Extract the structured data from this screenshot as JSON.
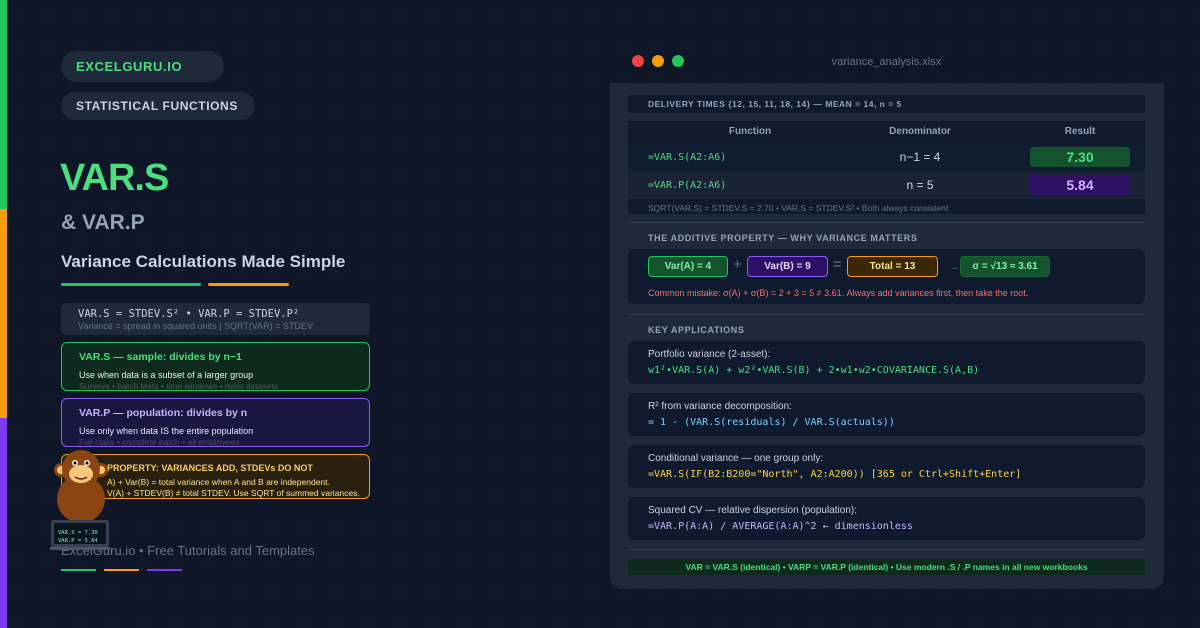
{
  "brand": "EXCELGURU.IO",
  "category": "STATISTICAL FUNCTIONS",
  "title": "VAR.S",
  "subtitle": "& VAR.P",
  "tagline": "Variance Calculations Made Simple",
  "colors": {
    "green": "#22c55e",
    "orange": "#f59e0b",
    "purple": "#7c3aed",
    "background": "#0f1628"
  },
  "formula_box": {
    "line1": "VAR.S = STDEV.S² • VAR.P = STDEV.P²",
    "line2": "Variance = spread in squared units | SQRT(VAR) = STDEV"
  },
  "cards": [
    {
      "heading": "VAR.S — sample: divides by n−1",
      "line1": "Use when data is a subset of a larger group",
      "line2": "Surveys • batch tests • time windows • most datasets"
    },
    {
      "heading": "VAR.P — population: divides by n",
      "line1": "Use only when data IS the entire population",
      "line2": "Full class • complete batch • all employees"
    },
    {
      "heading": "PROPERTY: VARIANCES ADD, STDEVs DO NOT",
      "line1": "A) + Var(B) = total variance when A and B are independent.",
      "line2": "V(A) + STDEV(B) ≠ total STDEV. Use SQRT of summed variances."
    }
  ],
  "footer": "ExcelGuru.io • Free Tutorials and Templates",
  "mascot_screen": {
    "line1": "VAR.S = 7.30",
    "line2": "VAR.P = 5.84"
  },
  "window": {
    "title": "variance_analysis.xlsx",
    "data_title": "DELIVERY TIMES {12, 15, 11, 18, 14} — MEAN = 14, n = 5",
    "table": {
      "headers": [
        "Function",
        "Denominator",
        "Result"
      ],
      "rows": [
        {
          "fn": "=VAR.S(A2:A6)",
          "den": "n−1 = 4",
          "res": "7.30"
        },
        {
          "fn": "=VAR.P(A2:A6)",
          "den": "n = 5",
          "res": "5.84"
        }
      ],
      "note": "SQRT(VAR.S) = STDEV.S = 2.70 • VAR.S = STDEV.S² • Both always consistent"
    },
    "additive": {
      "label": "THE ADDITIVE PROPERTY — WHY VARIANCE MATTERS",
      "chip_a": "Var(A) = 4",
      "plus": "+",
      "chip_b": "Var(B) = 9",
      "equals": "=",
      "chip_total": "Total = 13",
      "arrow": "→",
      "chip_sigma": "σ = √13 ≈ 3.61",
      "mistake": "Common mistake: σ(A) + σ(B) = 2 + 3 = 5 ≠ 3.61. Always add variances first, then take the root."
    },
    "applications": {
      "label": "KEY APPLICATIONS",
      "items": [
        {
          "label": "Portfolio variance (2-asset):",
          "formula": "w1²•VAR.S(A) + w2²•VAR.S(B) + 2•w1•w2•COVARIANCE.S(A,B)"
        },
        {
          "label": "R² from variance decomposition:",
          "formula": "= 1 - (VAR.S(residuals) / VAR.S(actuals))"
        },
        {
          "label": "Conditional variance — one group only:",
          "formula": "=VAR.S(IF(B2:B200=\"North\", A2:A200)) [365 or Ctrl+Shift+Enter]"
        },
        {
          "label": "Squared CV — relative dispersion (population):",
          "formula": "=VAR.P(A:A) / AVERAGE(A:A)^2 ← dimensionless"
        }
      ]
    },
    "bottom_note": "VAR = VAR.S (identical) • VARP = VAR.P (identical) • Use modern .S / .P names in all new workbooks"
  }
}
